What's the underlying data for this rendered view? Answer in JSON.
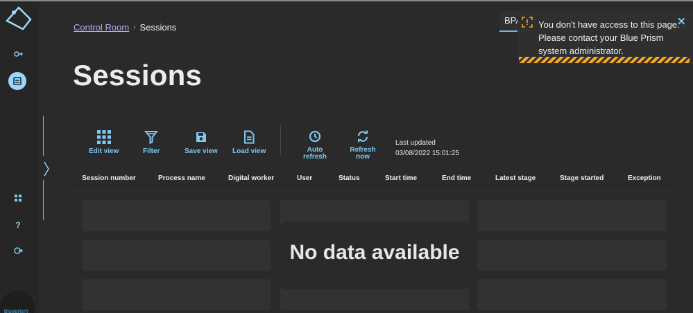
{
  "breadcrumb": {
    "parent": "Control Room",
    "separator": "›",
    "current": "Sessions"
  },
  "page": {
    "title": "Sessions"
  },
  "toolbar": {
    "edit_view": "Edit view",
    "filter": "Filter",
    "save_view": "Save view",
    "load_view": "Load view",
    "auto_refresh": "Auto refresh",
    "refresh_now": "Refresh now",
    "last_updated_label": "Last updated",
    "last_updated_value": "03/08/2022 15:01:25"
  },
  "table": {
    "columns": [
      "Session number",
      "Process name",
      "Digital worker",
      "User",
      "Status",
      "Start time",
      "End time",
      "Latest stage",
      "Stage started",
      "Exception"
    ],
    "empty_message": "No data available"
  },
  "search": {
    "value": "BPA"
  },
  "toast": {
    "message": "You don't have access to this page. Please contact your Blue Prism system administrator.",
    "close": "✕"
  },
  "sidebar": {
    "icons": [
      "processes-icon",
      "control-room-icon",
      "dashboard-icon",
      "help-icon",
      "sign-out-icon"
    ],
    "brand": "blueprism"
  },
  "colors": {
    "accent": "#7ec8f2",
    "link": "#b9a6ff",
    "warning": "#f5a623",
    "background": "#2a2a2a"
  }
}
